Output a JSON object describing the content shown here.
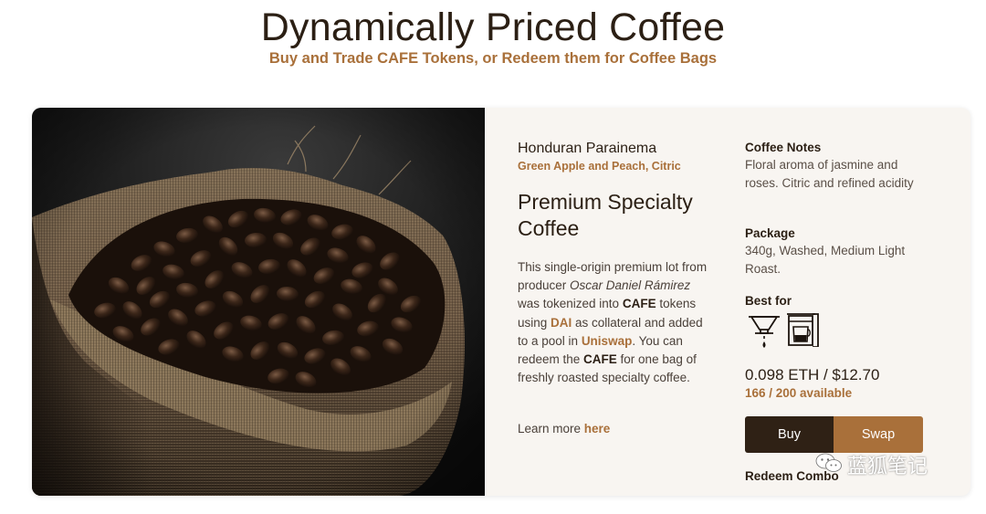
{
  "hero": {
    "title": "Dynamically Priced Coffee",
    "subtitle": "Buy and Trade CAFE Tokens, or Redeem them for Coffee Bags"
  },
  "product": {
    "origin": "Honduran Parainema",
    "flavor": "Green Apple and Peach, Citric",
    "title": "Premium Specialty Coffee",
    "description": {
      "p1": "This single-origin premium lot from producer ",
      "producer": "Oscar Daniel Rámirez",
      "p2": " was tokenized into ",
      "token1": "CAFE",
      "p3": " tokens using ",
      "dai": "DAI",
      "p4": " as collateral and added to a pool in ",
      "uniswap": "Uniswap",
      "p5": ". You can redeem the ",
      "token2": "CAFE",
      "p6": " for one bag of freshly roasted specialty coffee."
    },
    "learn_more": {
      "prefix": "Learn more ",
      "link": "here"
    },
    "notes": {
      "label": "Coffee Notes",
      "text": "Floral aroma of jasmine and roses. Citric and refined acidity"
    },
    "package": {
      "label": "Package",
      "text": "340g, Washed, Medium Light Roast."
    },
    "best_for": {
      "label": "Best for",
      "icons": [
        "pour-over-dripper-icon",
        "drip-coffee-maker-icon"
      ]
    },
    "price": "0.098 ETH / $12.70",
    "availability": "166 / 200 available",
    "buttons": {
      "buy": "Buy",
      "swap": "Swap"
    },
    "redeem": "Redeem Combo"
  },
  "watermark": "蓝狐笔记",
  "colors": {
    "accent": "#a9703a",
    "dark": "#2f2115",
    "card_bg": "#f8f5f1"
  }
}
